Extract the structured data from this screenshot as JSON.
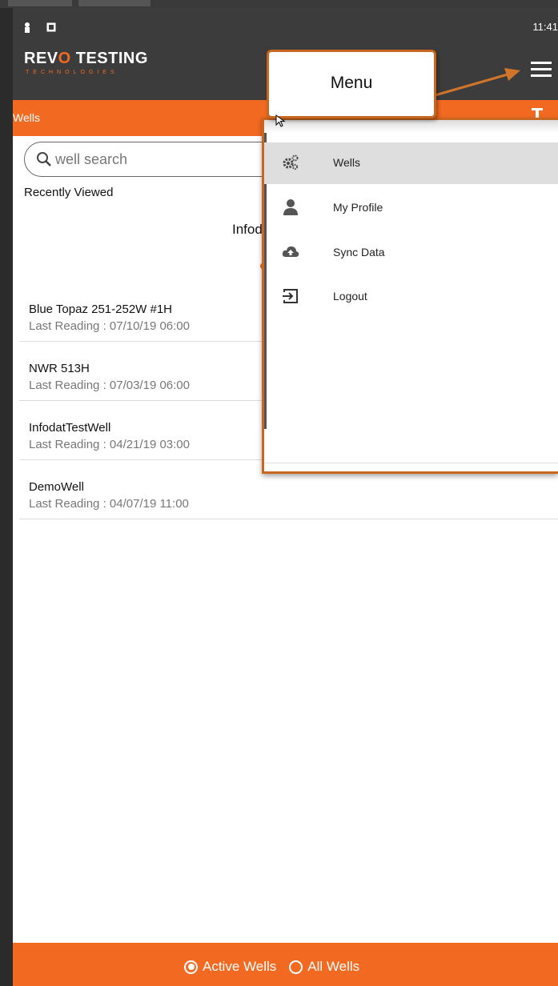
{
  "status_bar": {
    "time": "11:41"
  },
  "app": {
    "logo_main_1": "REV",
    "logo_main_o": "O",
    "logo_main_2": " TESTING",
    "logo_sub": "TECHNOLOGIES"
  },
  "header": {
    "title": "Wells"
  },
  "search": {
    "placeholder": "well search"
  },
  "recently_viewed": {
    "label": "Recently Viewed",
    "partial_title": "Infod"
  },
  "wells": [
    {
      "name": "Blue Topaz 251-252W #1H",
      "last_reading": "Last Reading : 07/10/19 06:00"
    },
    {
      "name": "NWR 513H",
      "last_reading": "Last Reading : 07/03/19 06:00"
    },
    {
      "name": "InfodatTestWell",
      "last_reading": "Last Reading : 04/21/19 03:00"
    },
    {
      "name": "DemoWell",
      "last_reading": "Last Reading : 04/07/19 11:00"
    }
  ],
  "menu": {
    "items": [
      {
        "label": "Wells",
        "icon": "gears-icon",
        "active": true
      },
      {
        "label": "My Profile",
        "icon": "person-icon"
      },
      {
        "label": "Sync Data",
        "icon": "cloud-upload-icon"
      },
      {
        "label": "Logout",
        "icon": "logout-icon"
      }
    ]
  },
  "callout": {
    "text": "Menu"
  },
  "filter": {
    "active_label": "Active Wells",
    "all_label": "All Wells",
    "selected": "Active Wells"
  },
  "colors": {
    "accent": "#f26a21",
    "appbar": "#3c3c3c",
    "callout_border": "#c9661f"
  }
}
